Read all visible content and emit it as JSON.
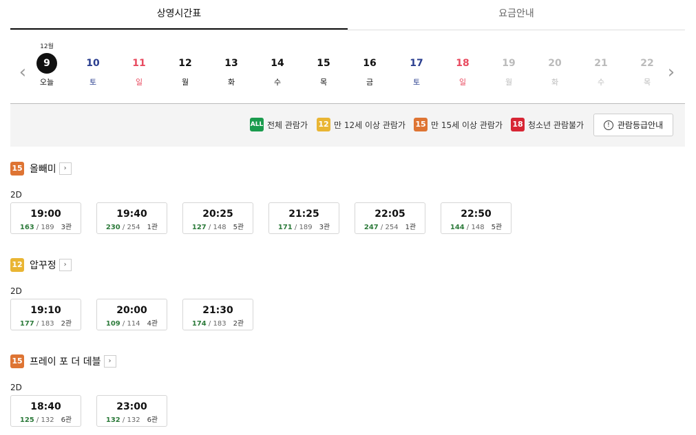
{
  "tabs": [
    {
      "label": "상영시간표",
      "active": true
    },
    {
      "label": "요금안내",
      "active": false
    }
  ],
  "date_strip": {
    "month_label": "12월",
    "days": [
      {
        "num": "9",
        "wd": "오늘",
        "color": "black",
        "today": true
      },
      {
        "num": "10",
        "wd": "토",
        "color": "blue"
      },
      {
        "num": "11",
        "wd": "일",
        "color": "red"
      },
      {
        "num": "12",
        "wd": "월",
        "color": "black"
      },
      {
        "num": "13",
        "wd": "화",
        "color": "black"
      },
      {
        "num": "14",
        "wd": "수",
        "color": "black"
      },
      {
        "num": "15",
        "wd": "목",
        "color": "black"
      },
      {
        "num": "16",
        "wd": "금",
        "color": "black"
      },
      {
        "num": "17",
        "wd": "토",
        "color": "blue"
      },
      {
        "num": "18",
        "wd": "일",
        "color": "red"
      },
      {
        "num": "19",
        "wd": "월",
        "color": "gray"
      },
      {
        "num": "20",
        "wd": "화",
        "color": "gray"
      },
      {
        "num": "21",
        "wd": "수",
        "color": "gray"
      },
      {
        "num": "22",
        "wd": "목",
        "color": "gray"
      }
    ]
  },
  "legend": {
    "items": [
      {
        "badge": "ALL",
        "label": "전체 관람가",
        "color": "#1a9b4d"
      },
      {
        "badge": "12",
        "label": "만 12세 이상 관람가",
        "color": "#e9b533"
      },
      {
        "badge": "15",
        "label": "만 15세 이상 관람가",
        "color": "#de7433"
      },
      {
        "badge": "18",
        "label": "청소년 관람불가",
        "color": "#d72534"
      }
    ],
    "guide_button": "관람등급안내"
  },
  "movies": [
    {
      "rating": "15",
      "rating_color": "#de7433",
      "title": "올빼미",
      "format": "2D",
      "slots": [
        {
          "time": "19:00",
          "avail": "163",
          "total": "189",
          "hall": "3관"
        },
        {
          "time": "19:40",
          "avail": "230",
          "total": "254",
          "hall": "1관"
        },
        {
          "time": "20:25",
          "avail": "127",
          "total": "148",
          "hall": "5관"
        },
        {
          "time": "21:25",
          "avail": "171",
          "total": "189",
          "hall": "3관"
        },
        {
          "time": "22:05",
          "avail": "247",
          "total": "254",
          "hall": "1관"
        },
        {
          "time": "22:50",
          "avail": "144",
          "total": "148",
          "hall": "5관"
        }
      ]
    },
    {
      "rating": "12",
      "rating_color": "#e9b533",
      "title": "압꾸정",
      "format": "2D",
      "slots": [
        {
          "time": "19:10",
          "avail": "177",
          "total": "183",
          "hall": "2관"
        },
        {
          "time": "20:00",
          "avail": "109",
          "total": "114",
          "hall": "4관"
        },
        {
          "time": "21:30",
          "avail": "174",
          "total": "183",
          "hall": "2관"
        }
      ]
    },
    {
      "rating": "15",
      "rating_color": "#de7433",
      "title": "프레이 포 더 데블",
      "format": "2D",
      "slots": [
        {
          "time": "18:40",
          "avail": "125",
          "total": "132",
          "hall": "6관"
        },
        {
          "time": "23:00",
          "avail": "132",
          "total": "132",
          "hall": "6관"
        }
      ]
    }
  ]
}
